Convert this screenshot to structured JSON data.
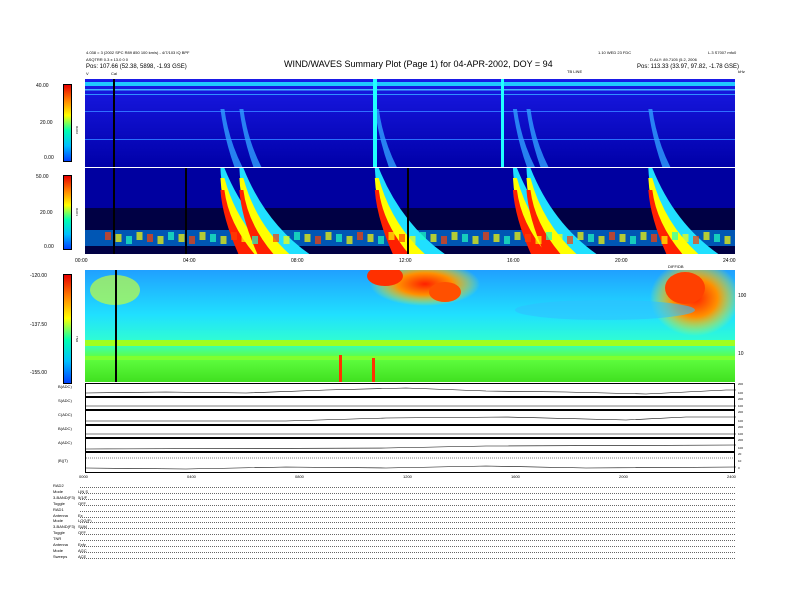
{
  "header": {
    "title": "WIND/WAVES Summary Plot (Page 1) for 04-APR-2002, DOY = 94",
    "left_line1": "4.038 = 3 (2002 SPC R89 850 100 km/s) - 4/7/103 IQ BPF",
    "left_line2": "ASQTRR 0.3 x 13.0 0 0",
    "left_line3": "Pos: 107.66 (52.38, 5898, -1.93 GSE)",
    "right_line1": "1.10 WED 23 FDC",
    "right_line2": "D.ALY: 89.7105 (5.2, 2006",
    "right_line3": "Pos: 113.33 (33.97, 97.82, -1.78 GSE)",
    "far_right": "L.3 S7007 mfo0",
    "tb_label": "TB LINE",
    "unit_label": "kHz",
    "cal_label": "Cal",
    "v_label": "V"
  },
  "rad2": {
    "label": "RAD2",
    "ticks": [
      "40.00",
      "20.00",
      "0.00"
    ]
  },
  "rad1": {
    "label": "RAD1",
    "ticks": [
      "50.00",
      "20.00",
      "0.00"
    ]
  },
  "tnr": {
    "label": "TNR",
    "ticks": [
      "-120.00",
      "-137.50",
      "-155.00"
    ],
    "right_ticks": [
      "100",
      "10"
    ],
    "top_right": "DIFF/DB"
  },
  "time_axis": [
    "00:00",
    "04:00",
    "08:00",
    "12:00",
    "16:00",
    "20:00",
    "24:00"
  ],
  "bottom_axis": [
    "0000",
    "0400",
    "0800",
    "1200",
    "1600",
    "2000",
    "2400"
  ],
  "ts_panels": [
    {
      "label": "B(ADC)",
      "ticks": [
        "200",
        "100"
      ]
    },
    {
      "label": "S(ADC)",
      "ticks": [
        "200",
        "100"
      ]
    },
    {
      "label": "C(ADC)",
      "ticks": [
        "200",
        "100"
      ]
    },
    {
      "label": "B(ADC)",
      "ticks": [
        "200",
        "100"
      ]
    },
    {
      "label": "A(ADC)",
      "ticks": [
        "200",
        "100"
      ]
    },
    {
      "label": "|B|(T)",
      "ticks": [
        "20",
        "10",
        "0"
      ]
    }
  ],
  "status": [
    {
      "k": "RAD2",
      "v": ""
    },
    {
      "k": "Mode",
      "v": "LIN S"
    },
    {
      "k": "3-BAND(F3)",
      "v": "5/1/F"
    },
    {
      "k": "Toggle",
      "v": "OFF"
    },
    {
      "k": "RAD1",
      "v": ""
    },
    {
      "k": "Antenna",
      "v": "Ex"
    },
    {
      "k": "Mode",
      "v": "LOG(F)"
    },
    {
      "k": "3-BAND(F3)",
      "v": "SUM"
    },
    {
      "k": "Toggle",
      "v": "OFF"
    },
    {
      "k": "TNR",
      "v": ""
    },
    {
      "k": "Antenna",
      "v": "Exfy"
    },
    {
      "k": "Mode",
      "v": "AGC"
    },
    {
      "k": "Sweeps",
      "v": "ACE"
    }
  ],
  "chart_data": {
    "type": "heatmap",
    "title": "WIND/WAVES Summary Plot (Page 1) for 04-APR-2002, DOY = 94",
    "x_range": [
      "00:00",
      "24:00"
    ],
    "panels": [
      {
        "name": "RAD2",
        "ylim": [
          0,
          40
        ]
      },
      {
        "name": "RAD1",
        "ylim": [
          0,
          50
        ]
      },
      {
        "name": "TNR",
        "ylim": [
          -155,
          -120
        ]
      }
    ],
    "bursts_hours": [
      5.0,
      5.7,
      10.7,
      15.8,
      16.3,
      20.8
    ],
    "colors": {
      "low": "#0000cc",
      "mid": "#00ffff",
      "high": "#ff0000"
    }
  }
}
